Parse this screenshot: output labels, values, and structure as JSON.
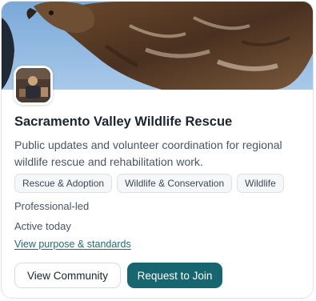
{
  "community": {
    "name": "Sacramento Valley Wildlife Rescue",
    "description": "Public updates and volunteer coordination for regional wildlife rescue and rehabilitation work.",
    "tags": [
      "Rescue & Adoption",
      "Wildlife & Conservation",
      "Wildlife"
    ],
    "leadership": "Professional-led",
    "activity": "Active today",
    "standards_link": "View purpose & standards"
  },
  "actions": {
    "view_label": "View Community",
    "join_label": "Request to Join"
  },
  "colors": {
    "primary": "#17666f",
    "link": "#1f6a78",
    "banner_sky": "#8ab4df"
  }
}
